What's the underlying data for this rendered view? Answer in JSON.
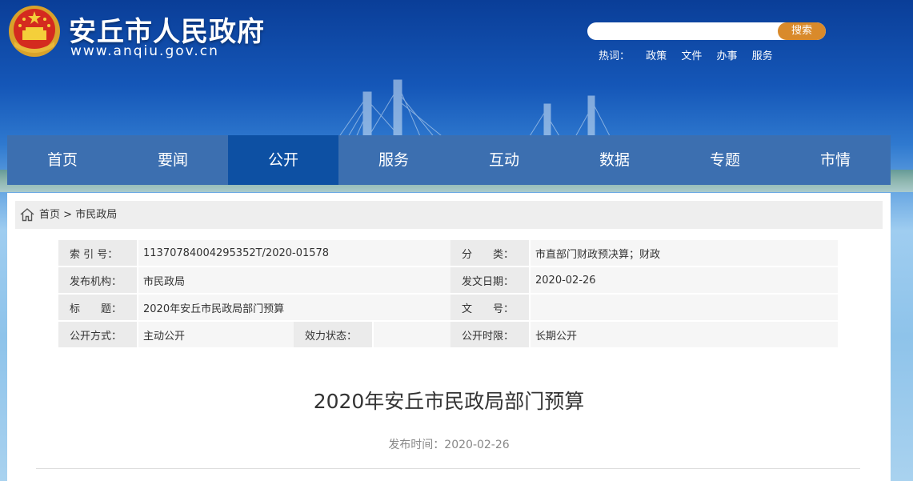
{
  "header": {
    "site_title": "安丘市人民政府",
    "site_url": "www.anqiu.gov.cn",
    "search": {
      "placeholder": "",
      "button_label": "搜索"
    },
    "hotwords": {
      "label": "热词：",
      "items": [
        "政策",
        "文件",
        "办事",
        "服务"
      ]
    }
  },
  "nav": {
    "items": [
      "首页",
      "要闻",
      "公开",
      "服务",
      "互动",
      "数据",
      "专题",
      "市情"
    ],
    "active": "公开"
  },
  "breadcrumb": {
    "home": "首页",
    "separator": ">",
    "current": "市民政局"
  },
  "meta": {
    "index_label": "索 引 号：",
    "index_value": "11370784004295352T/2020-01578",
    "category_label": "分　　类：",
    "category_value": "市直部门财政预决算；财政",
    "publisher_label": "发布机构：",
    "publisher_value": "市民政局",
    "date_label": "发文日期：",
    "date_value": "2020-02-26",
    "title_label": "标　　题：",
    "title_value": "2020年安丘市民政局部门预算",
    "docno_label": "文　　号：",
    "docno_value": "",
    "openmode_label": "公开方式：",
    "openmode_value": "主动公开",
    "validity_label": "效力状态：",
    "validity_value": "",
    "term_label": "公开时限：",
    "term_value": "长期公开"
  },
  "article": {
    "title": "2020年安丘市民政局部门预算",
    "publish_date": "发布时间：2020-02-26"
  },
  "colors": {
    "nav_bg": "#3c6fb0",
    "nav_active": "#0d50a3",
    "search_button": "#d98a2b"
  }
}
